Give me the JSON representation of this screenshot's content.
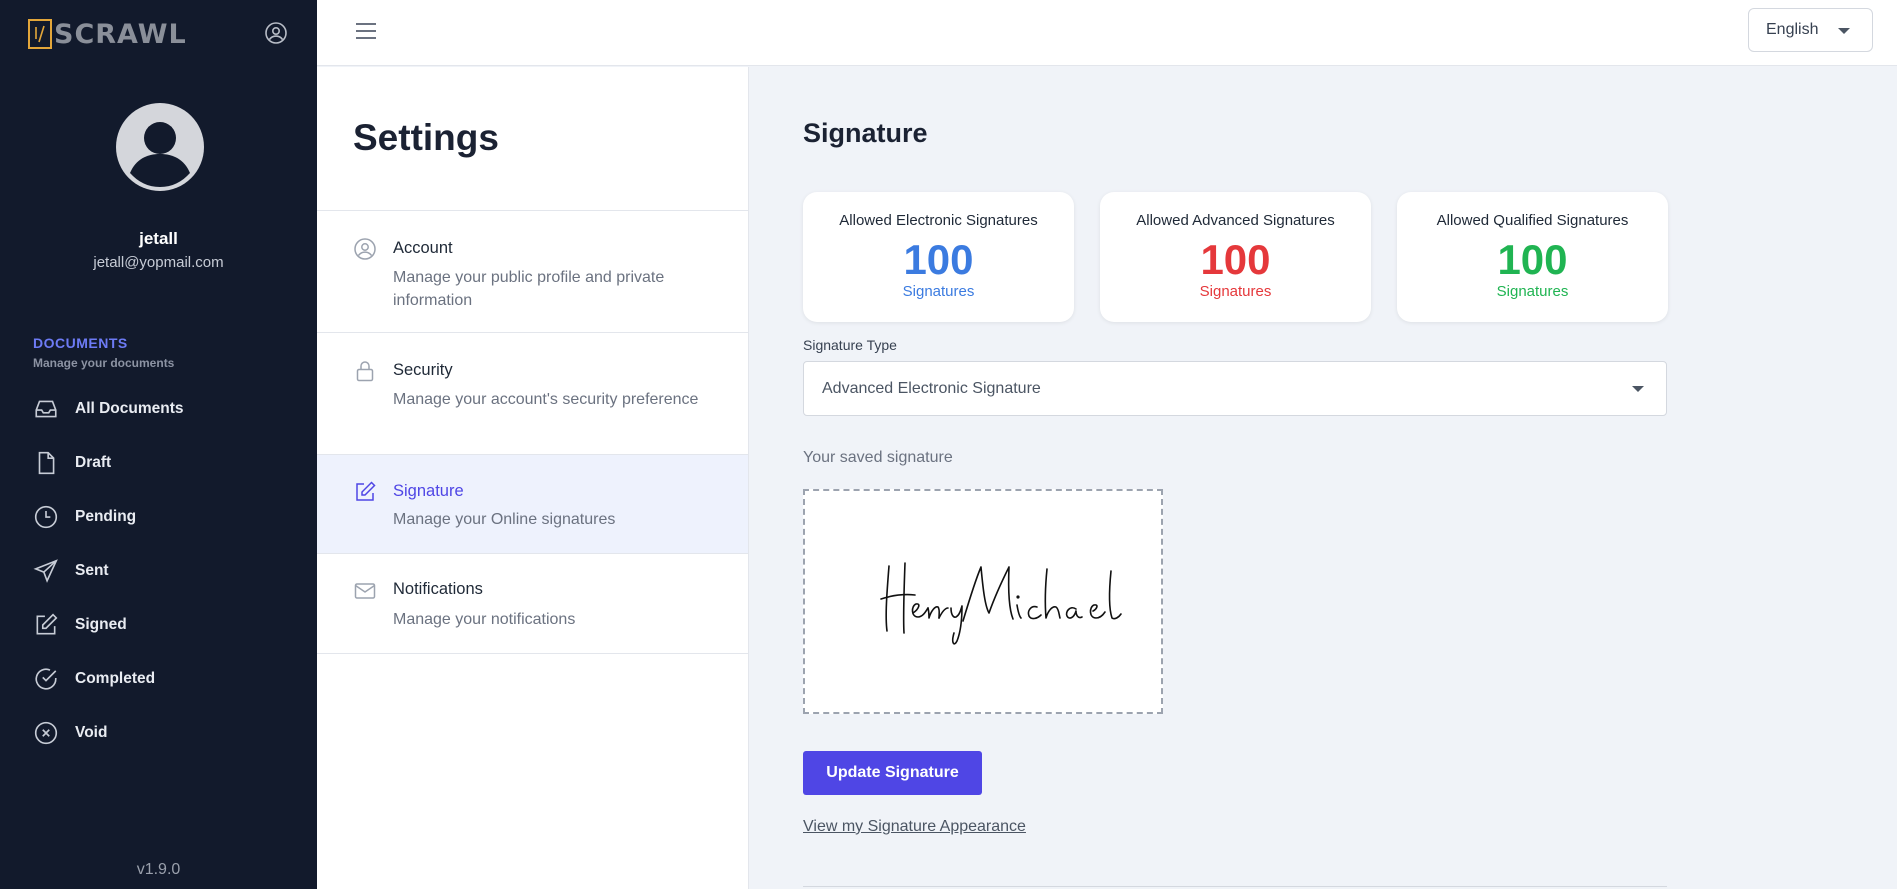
{
  "app": {
    "logo_text": "SCRAWL",
    "logo_mark": "//",
    "version": "v1.9.0"
  },
  "user": {
    "name": "jetall",
    "email": "jetall@yopmail.com"
  },
  "sidebar": {
    "section_title": "DOCUMENTS",
    "section_subtitle": "Manage your documents",
    "items": [
      {
        "label": "All Documents",
        "icon": "inbox-icon"
      },
      {
        "label": "Draft",
        "icon": "file-icon"
      },
      {
        "label": "Pending",
        "icon": "clock-icon"
      },
      {
        "label": "Sent",
        "icon": "send-icon"
      },
      {
        "label": "Signed",
        "icon": "pen-square-icon"
      },
      {
        "label": "Completed",
        "icon": "check-circle-icon"
      },
      {
        "label": "Void",
        "icon": "x-circle-icon"
      }
    ]
  },
  "topbar": {
    "language": "English"
  },
  "settings": {
    "title": "Settings",
    "items": [
      {
        "title": "Account",
        "desc": "Manage your public profile and private information",
        "icon": "user-circle-icon"
      },
      {
        "title": "Security",
        "desc": "Manage your account's security preference",
        "icon": "lock-icon"
      },
      {
        "title": "Signature",
        "desc": "Manage your Online signatures",
        "icon": "edit-icon",
        "active": true
      },
      {
        "title": "Notifications",
        "desc": "Manage your notifications",
        "icon": "mail-icon"
      }
    ]
  },
  "main": {
    "title": "Signature",
    "cards": [
      {
        "label": "Allowed Electronic Signatures",
        "value": "100",
        "unit": "Signatures",
        "color": "#3b7be0"
      },
      {
        "label": "Allowed Advanced Signatures",
        "value": "100",
        "unit": "Signatures",
        "color": "#e5383b"
      },
      {
        "label": "Allowed Qualified Signatures",
        "value": "100",
        "unit": "Signatures",
        "color": "#20b452"
      }
    ],
    "signature_type_label": "Signature Type",
    "signature_type_value": "Advanced Electronic Signature",
    "saved_label": "Your saved signature",
    "signature_text": "Henry Michael",
    "update_button": "Update Signature",
    "view_link": "View my Signature Appearance"
  }
}
